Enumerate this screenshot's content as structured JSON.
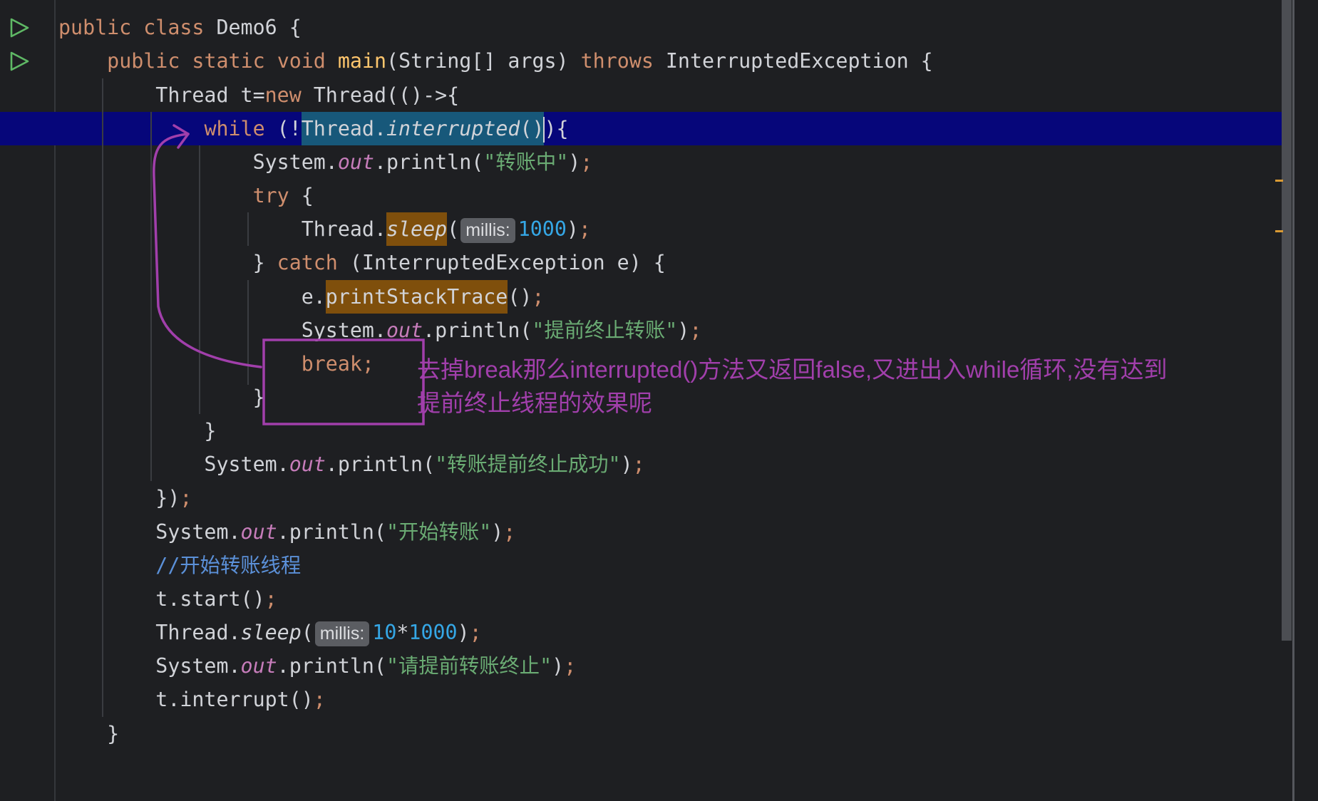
{
  "colors": {
    "background": "#1e1f22",
    "caret_line": "#06067a",
    "selection": "#17587a",
    "warning_highlight": "#7f4f0c",
    "keyword": "#cf8e6d",
    "method_name": "#ffc66d",
    "plain_text": "#d1d3d8",
    "static_field": "#c77dbb",
    "string": "#6aab73",
    "number": "#35a7e6",
    "comment": "#5b90d8",
    "parameter_hint_bg": "#5b5d62",
    "warning_stripe": "#d99a34",
    "annotation": "#a13fab",
    "run_icon": "#5fb865"
  },
  "gutter": {
    "run_icons": [
      "run-class-icon",
      "run-main-icon"
    ]
  },
  "scrollbar": {
    "thumb_fraction": 0.8,
    "stripe_marks": [
      "warning-stripe-mark",
      "warning-stripe-mark"
    ]
  },
  "editor": {
    "lines": [
      {
        "tokens": [
          {
            "t": "kw",
            "v": "public"
          },
          {
            "t": "pl",
            "v": " "
          },
          {
            "t": "kw",
            "v": "class"
          },
          {
            "t": "pl",
            "v": " Demo6 {"
          }
        ]
      },
      {
        "tokens": [
          {
            "t": "pl",
            "v": "    "
          },
          {
            "t": "kw",
            "v": "public"
          },
          {
            "t": "pl",
            "v": " "
          },
          {
            "t": "kw",
            "v": "static"
          },
          {
            "t": "pl",
            "v": " "
          },
          {
            "t": "kw",
            "v": "void"
          },
          {
            "t": "pl",
            "v": " "
          },
          {
            "t": "fn",
            "v": "main"
          },
          {
            "t": "pl",
            "v": "(String[] args) "
          },
          {
            "t": "kw",
            "v": "throws"
          },
          {
            "t": "pl",
            "v": " InterruptedException {"
          }
        ]
      },
      {
        "tokens": [
          {
            "t": "pl",
            "v": "        Thread t="
          },
          {
            "t": "kw",
            "v": "new"
          },
          {
            "t": "pl",
            "v": " Thread(()->{"
          }
        ]
      },
      {
        "tokens": [
          {
            "t": "pl",
            "v": "            "
          },
          {
            "t": "kw",
            "v": "while"
          },
          {
            "t": "pl",
            "v": " (!"
          },
          {
            "t": "pl",
            "v": "Thread.",
            "sel": true
          },
          {
            "t": "it",
            "v": "interrupted",
            "sel": true
          },
          {
            "t": "pl",
            "v": "()",
            "sel": true
          },
          {
            "t": "caret"
          },
          {
            "t": "pl",
            "v": "){"
          }
        ]
      },
      {
        "tokens": [
          {
            "t": "pl",
            "v": "                System."
          },
          {
            "t": "st",
            "v": "out"
          },
          {
            "t": "pl",
            "v": ".println("
          },
          {
            "t": "str",
            "v": "\"转账中\""
          },
          {
            "t": "pl",
            "v": ")"
          },
          {
            "t": "semi",
            "v": ";"
          }
        ]
      },
      {
        "tokens": [
          {
            "t": "pl",
            "v": "                "
          },
          {
            "t": "kw",
            "v": "try"
          },
          {
            "t": "pl",
            "v": " {"
          }
        ]
      },
      {
        "tokens": [
          {
            "t": "pl",
            "v": "                    Thread."
          },
          {
            "t": "it",
            "v": "sleep",
            "warn": true
          },
          {
            "t": "pl",
            "v": "("
          },
          {
            "t": "hint",
            "v": "millis:"
          },
          {
            "t": "num",
            "v": "1000"
          },
          {
            "t": "pl",
            "v": ")"
          },
          {
            "t": "semi",
            "v": ";"
          }
        ]
      },
      {
        "tokens": [
          {
            "t": "pl",
            "v": "                } "
          },
          {
            "t": "kw",
            "v": "catch"
          },
          {
            "t": "pl",
            "v": " (InterruptedException e) {"
          }
        ]
      },
      {
        "tokens": [
          {
            "t": "pl",
            "v": "                    e."
          },
          {
            "t": "pl",
            "v": "printStackTrace",
            "warn": true
          },
          {
            "t": "pl",
            "v": "()"
          },
          {
            "t": "semi",
            "v": ";"
          }
        ]
      },
      {
        "tokens": [
          {
            "t": "pl",
            "v": "                    System."
          },
          {
            "t": "st",
            "v": "out"
          },
          {
            "t": "pl",
            "v": ".println("
          },
          {
            "t": "str",
            "v": "\"提前终止转账\""
          },
          {
            "t": "pl",
            "v": ")"
          },
          {
            "t": "semi",
            "v": ";"
          }
        ]
      },
      {
        "tokens": [
          {
            "t": "pl",
            "v": "                    "
          },
          {
            "t": "kw",
            "v": "break"
          },
          {
            "t": "semi",
            "v": ";"
          }
        ]
      },
      {
        "tokens": [
          {
            "t": "pl",
            "v": "                }"
          }
        ]
      },
      {
        "tokens": [
          {
            "t": "pl",
            "v": "            }"
          }
        ]
      },
      {
        "tokens": [
          {
            "t": "pl",
            "v": "            System."
          },
          {
            "t": "st",
            "v": "out"
          },
          {
            "t": "pl",
            "v": ".println("
          },
          {
            "t": "str",
            "v": "\"转账提前终止成功\""
          },
          {
            "t": "pl",
            "v": ")"
          },
          {
            "t": "semi",
            "v": ";"
          }
        ]
      },
      {
        "tokens": [
          {
            "t": "pl",
            "v": "        })"
          },
          {
            "t": "semi",
            "v": ";"
          }
        ]
      },
      {
        "tokens": [
          {
            "t": "pl",
            "v": "        System."
          },
          {
            "t": "st",
            "v": "out"
          },
          {
            "t": "pl",
            "v": ".println("
          },
          {
            "t": "str",
            "v": "\"开始转账\""
          },
          {
            "t": "pl",
            "v": ")"
          },
          {
            "t": "semi",
            "v": ";"
          }
        ]
      },
      {
        "tokens": [
          {
            "t": "pl",
            "v": "        "
          },
          {
            "t": "cm",
            "v": "//开始转账线程"
          }
        ]
      },
      {
        "tokens": [
          {
            "t": "pl",
            "v": "        t.start()"
          },
          {
            "t": "semi",
            "v": ";"
          }
        ]
      },
      {
        "tokens": [
          {
            "t": "pl",
            "v": "        Thread."
          },
          {
            "t": "it",
            "v": "sleep"
          },
          {
            "t": "pl",
            "v": "("
          },
          {
            "t": "hint",
            "v": "millis:"
          },
          {
            "t": "num",
            "v": "10"
          },
          {
            "t": "pl",
            "v": "*"
          },
          {
            "t": "num",
            "v": "1000"
          },
          {
            "t": "pl",
            "v": ")"
          },
          {
            "t": "semi",
            "v": ";"
          }
        ]
      },
      {
        "tokens": [
          {
            "t": "pl",
            "v": "        System."
          },
          {
            "t": "st",
            "v": "out"
          },
          {
            "t": "pl",
            "v": ".println("
          },
          {
            "t": "str",
            "v": "\"请提前转账终止\""
          },
          {
            "t": "pl",
            "v": ")"
          },
          {
            "t": "semi",
            "v": ";"
          }
        ]
      },
      {
        "tokens": [
          {
            "t": "pl",
            "v": "        t.interrupt()"
          },
          {
            "t": "semi",
            "v": ";"
          }
        ]
      },
      {
        "tokens": [
          {
            "t": "pl",
            "v": "    }"
          }
        ]
      }
    ]
  },
  "annotation": {
    "shapes": [
      "hand-drawn-arrow",
      "highlight-box"
    ],
    "text_lines": [
      "去掉break那么interrupted()方法又返回false,又进出入while循环,没有达到",
      "提前终止线程的效果呢"
    ]
  }
}
